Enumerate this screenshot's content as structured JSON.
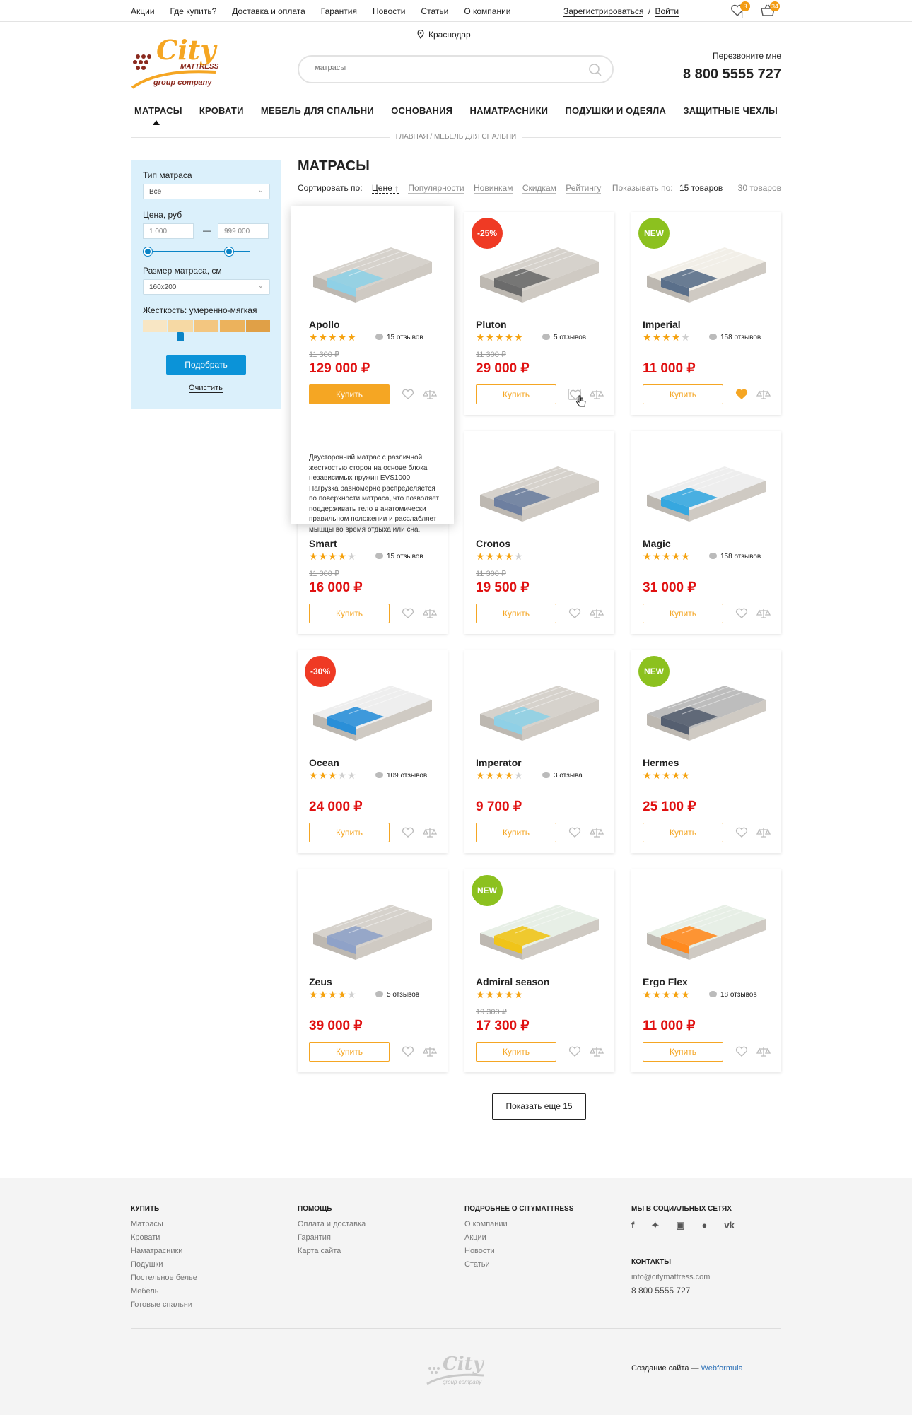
{
  "topbar": {
    "links": [
      "Акции",
      "Где купить?",
      "Доставка и оплата",
      "Гарантия",
      "Новости",
      "Статьи",
      "О компании"
    ],
    "register": "Зарегистрироваться",
    "separator": "/",
    "login": "Войти",
    "favorites_count": "3",
    "cart_count": "34"
  },
  "header": {
    "city": "Краснодар",
    "search_placeholder": "матрасы",
    "callback": "Перезвоните мне",
    "phone": "8 800 5555 727"
  },
  "nav": [
    "МАТРАСЫ",
    "КРОВАТИ",
    "МЕБЕЛЬ ДЛЯ СПАЛЬНИ",
    "ОСНОВАНИЯ",
    "НАМАТРАСНИКИ",
    "ПОДУШКИ И ОДЕЯЛА",
    "ЗАЩИТНЫЕ ЧЕХЛЫ"
  ],
  "breadcrumb": "ГЛАВНАЯ / МЕБЕЛЬ ДЛЯ СПАЛЬНИ",
  "filter": {
    "type_label": "Тип матраса",
    "type_value": "Все",
    "price_label": "Цена, руб",
    "price_from": "1 000",
    "price_to": "999 000",
    "price_dash": "—",
    "size_label": "Размер матраса, см",
    "size_value": "160x200",
    "firmness_label": "Жесткость: умеренно-мягкая",
    "firmness_colors": [
      "#f8e6c4",
      "#f6d9a4",
      "#f3c680",
      "#ecb25c",
      "#e0a047"
    ],
    "apply": "Подобрать",
    "clear": "Очистить"
  },
  "catalog": {
    "title": "МАТРАСЫ",
    "sort_label": "Сортировать по:",
    "sort_options": [
      "Цене ↑",
      "Популярности",
      "Новинкам",
      "Скидкам",
      "Рейтингу"
    ],
    "show_label": "Показывать по:",
    "show_15": "15 товаров",
    "show_30": "30 товаров",
    "buy_label": "Купить",
    "more": "Показать еще 15"
  },
  "products": [
    {
      "name": "Apollo",
      "rating": 5,
      "reviews": "15 отзывов",
      "old_price": "11 300 ₽",
      "price": "129 000 ₽",
      "label": "",
      "desc": "Двусторонний матрас с различной жесткостью сторон на основе блока независимых пружин EVS1000. Нагрузка равномерно распределяется по поверхности матраса, что позволяет поддерживать тело в анатомически правильном положении и расслабляет мышцы во время отдыха или сна."
    },
    {
      "name": "Pluton",
      "rating": 5,
      "reviews": "5 отзывов",
      "old_price": "11 300 ₽",
      "price": "29 000 ₽",
      "label": "-25%"
    },
    {
      "name": "Imperial",
      "rating": 4,
      "reviews": "158 отзывов",
      "old_price": "",
      "price": "11 000 ₽",
      "label": "NEW"
    },
    {
      "name": "Smart",
      "rating": 4,
      "reviews": "15 отзывов",
      "old_price": "11 300 ₽",
      "price": "16 000 ₽",
      "label": ""
    },
    {
      "name": "Cronos",
      "rating": 4,
      "reviews": "",
      "old_price": "11 300 ₽",
      "price": "19 500 ₽",
      "label": ""
    },
    {
      "name": "Magic",
      "rating": 5,
      "reviews": "158 отзывов",
      "old_price": "",
      "price": "31 000 ₽",
      "label": ""
    },
    {
      "name": "Ocean",
      "rating": 3,
      "reviews": "109 отзывов",
      "old_price": "",
      "price": "24 000 ₽",
      "label": "-30%"
    },
    {
      "name": "Imperator",
      "rating": 4,
      "reviews": "3 отзыва",
      "old_price": "",
      "price": "9 700 ₽",
      "label": ""
    },
    {
      "name": "Hermes",
      "rating": 5,
      "reviews": "",
      "old_price": "",
      "price": "25 100 ₽",
      "label": "NEW"
    },
    {
      "name": "Zeus",
      "rating": 4,
      "reviews": "5 отзывов",
      "old_price": "",
      "price": "39 000 ₽",
      "label": ""
    },
    {
      "name": "Admiral season",
      "rating": 5,
      "reviews": "",
      "old_price": "19 300 ₽",
      "price": "17 300 ₽",
      "label": "NEW"
    },
    {
      "name": "Ergo Flex",
      "rating": 5,
      "reviews": "18 отзывов",
      "old_price": "",
      "price": "11 000 ₽",
      "label": ""
    }
  ],
  "footer": {
    "col1_title": "КУПИТЬ",
    "col1": [
      "Матрасы",
      "Кровати",
      "Наматрасники",
      "Подушки",
      "Постельное белье",
      "Мебель",
      "Готовые спальни"
    ],
    "col2_title": "ПОМОЩЬ",
    "col2": [
      "Оплата и доставка",
      "Гарантия",
      "Карта сайта"
    ],
    "col3_title": "ПОДРОБНЕЕ О CITYMATTRESS",
    "col3": [
      "О компании",
      "Акции",
      "Новости",
      "Статьи"
    ],
    "col4_title": "МЫ В СОЦИАЛЬНЫХ СЕТЯХ",
    "socials": [
      "facebook-icon",
      "twitter-icon",
      "instagram-icon",
      "odnoklassniki-icon",
      "vk-icon"
    ],
    "contacts_title": "КОНТАКТЫ",
    "email": "info@citymattress.com",
    "phone": "8 800 5555 727",
    "credit_prefix": "Создание сайта —",
    "credit_link": "Webformula"
  },
  "logo": {
    "brand": "City",
    "sub": "MATTRESS",
    "tagline": "group company"
  }
}
